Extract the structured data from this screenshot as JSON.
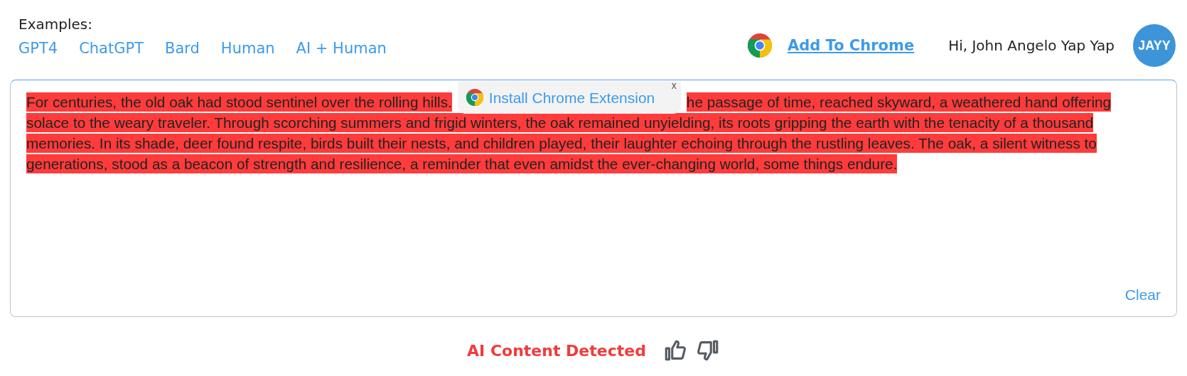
{
  "examples": {
    "label": "Examples:",
    "links": [
      "GPT4",
      "ChatGPT",
      "Bard",
      "Human",
      "AI + Human"
    ]
  },
  "header": {
    "add_to_chrome": "Add To Chrome",
    "greeting": "Hi, John Angelo Yap Yap",
    "avatar": "JAYY"
  },
  "editor": {
    "lines": [
      {
        "segments": [
          "For centuries, the old oak had stood sentinel over the rolling hills.",
          "he passage of time, reached skyward, a weathered hand offering"
        ]
      },
      {
        "segments": [
          "solace to the weary traveler. Through scorching summers and frigid winters, the oak remained unyielding, its roots gripping the earth with the tenacity of a thousand"
        ]
      },
      {
        "segments": [
          "memories. In its shade, deer found respite, birds built their nests, and children played, their laughter echoing through the rustling leaves. The oak, a silent witness to"
        ]
      },
      {
        "segments": [
          "generations, stood as a beacon of strength and resilience, a reminder that even amidst the ever-changing world, some things endure."
        ]
      }
    ],
    "popup": {
      "label": "Install Chrome Extension",
      "close": "x"
    },
    "clear": "Clear"
  },
  "result": {
    "label": "AI Content Detected"
  }
}
